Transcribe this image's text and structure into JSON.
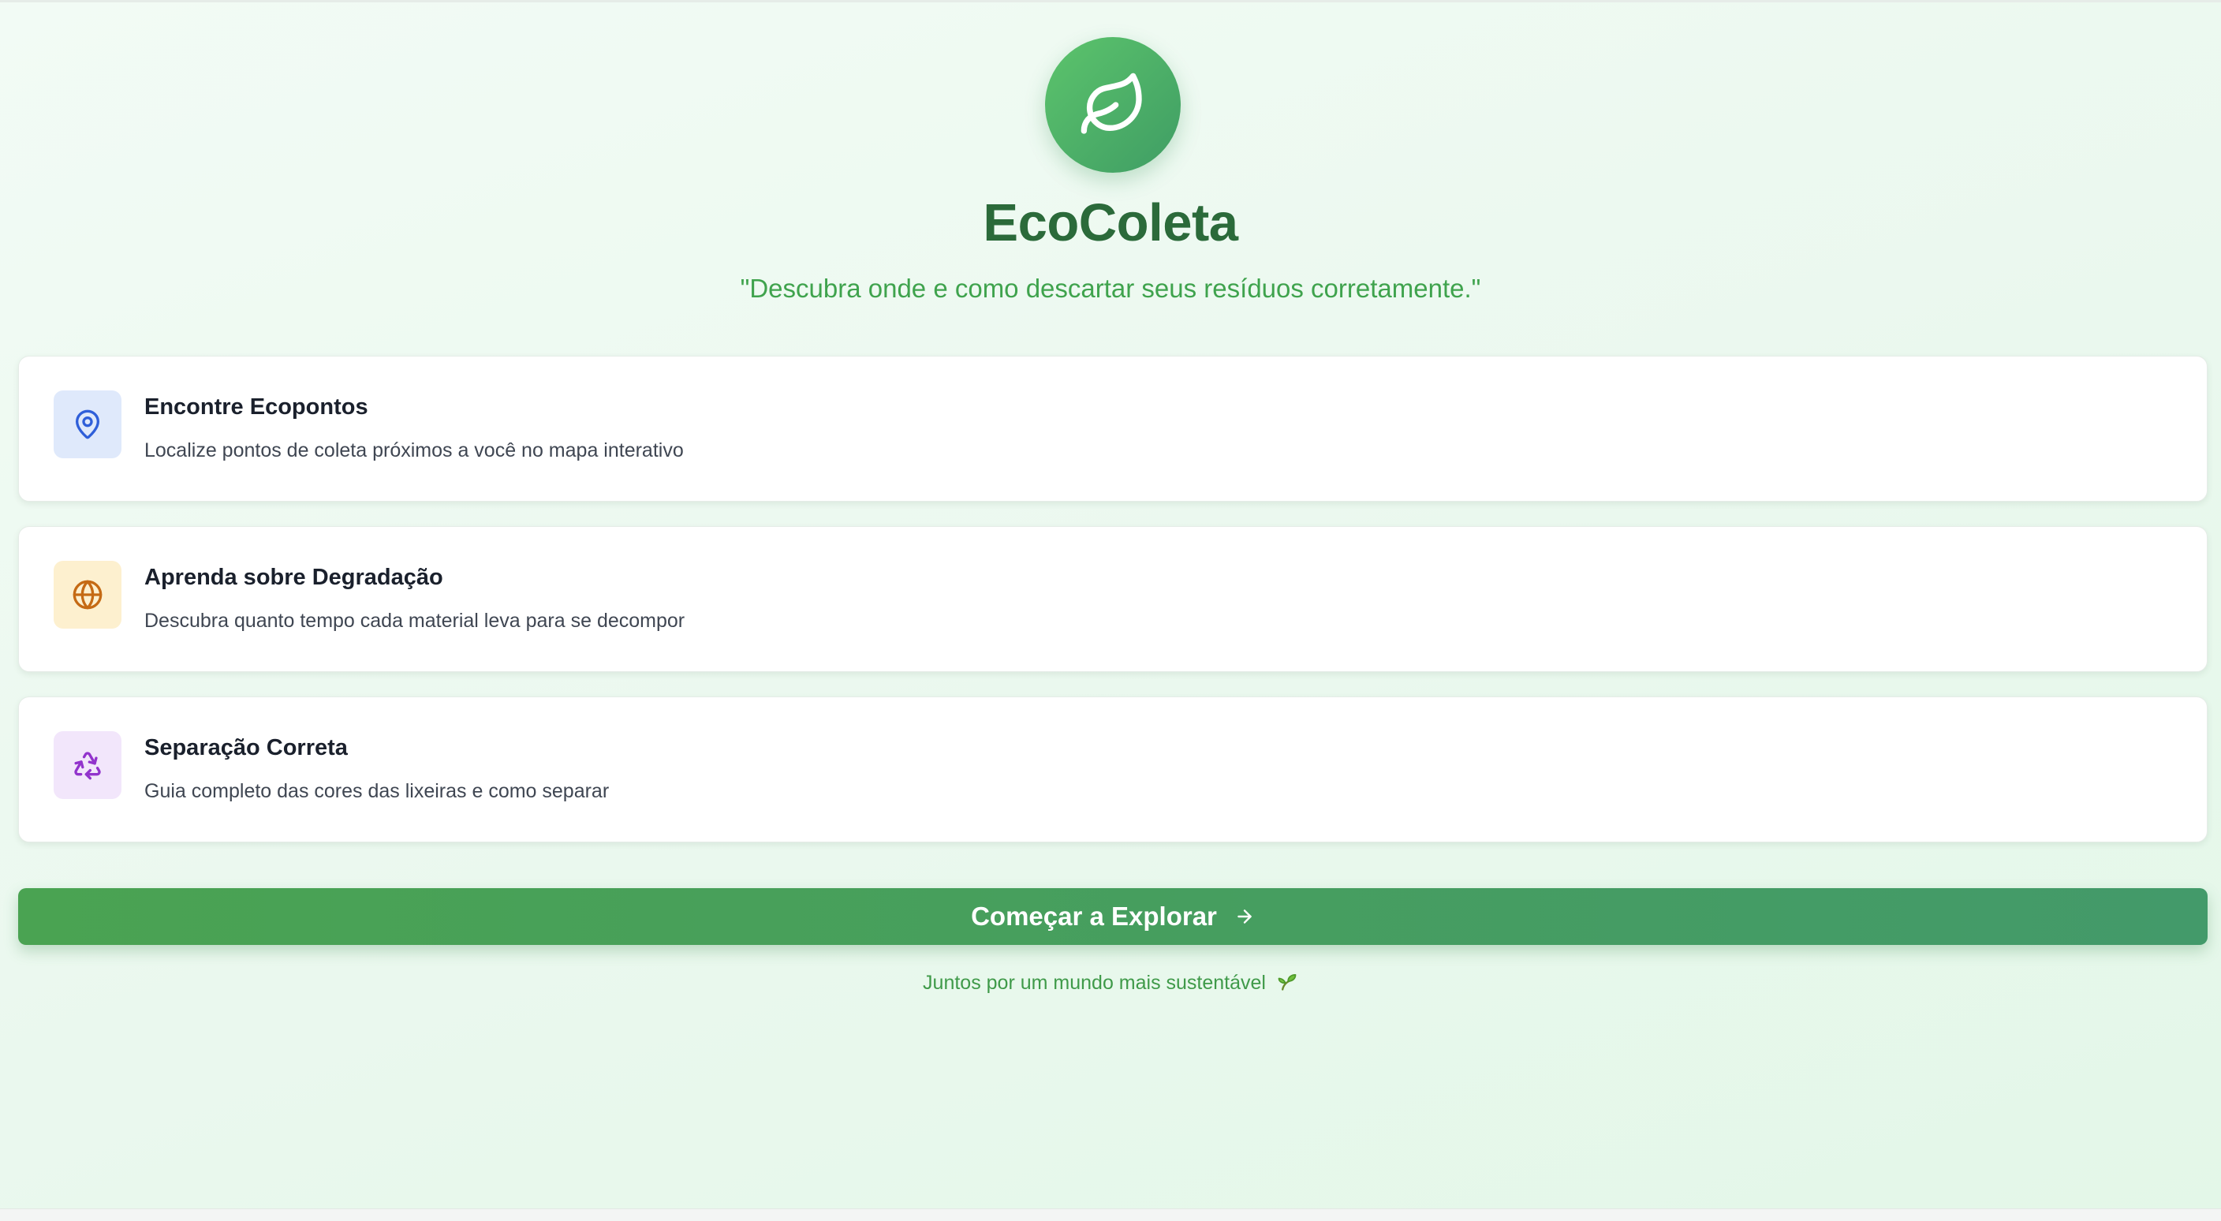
{
  "app": {
    "title": "EcoColeta",
    "tagline": "\"Descubra onde e como descartar seus resíduos corretamente.\"",
    "logo_icon": "leaf-icon"
  },
  "features": [
    {
      "title": "Encontre Ecopontos",
      "description": "Localize pontos de coleta próximos a você no mapa interativo",
      "icon": "map-pin-icon",
      "icon_color": "#2f5fd9",
      "icon_bg": "#dfe9fb"
    },
    {
      "title": "Aprenda sobre Degradação",
      "description": "Descubra quanto tempo cada material leva para se decompor",
      "icon": "globe-icon",
      "icon_color": "#c56a14",
      "icon_bg": "#fdf0cf"
    },
    {
      "title": "Separação Correta",
      "description": "Guia completo das cores das lixeiras e como separar",
      "icon": "recycle-icon",
      "icon_color": "#9233cc",
      "icon_bg": "#f2e6fb"
    }
  ],
  "cta": {
    "label": "Começar a Explorar",
    "icon": "arrow-right-icon"
  },
  "footer": {
    "note": "Juntos por um mundo mais sustentável",
    "emoji_icon": "sprout-icon"
  },
  "colors": {
    "primary": "#4aa352",
    "title": "#2b6a3a",
    "accent_text": "#3fa34d"
  }
}
